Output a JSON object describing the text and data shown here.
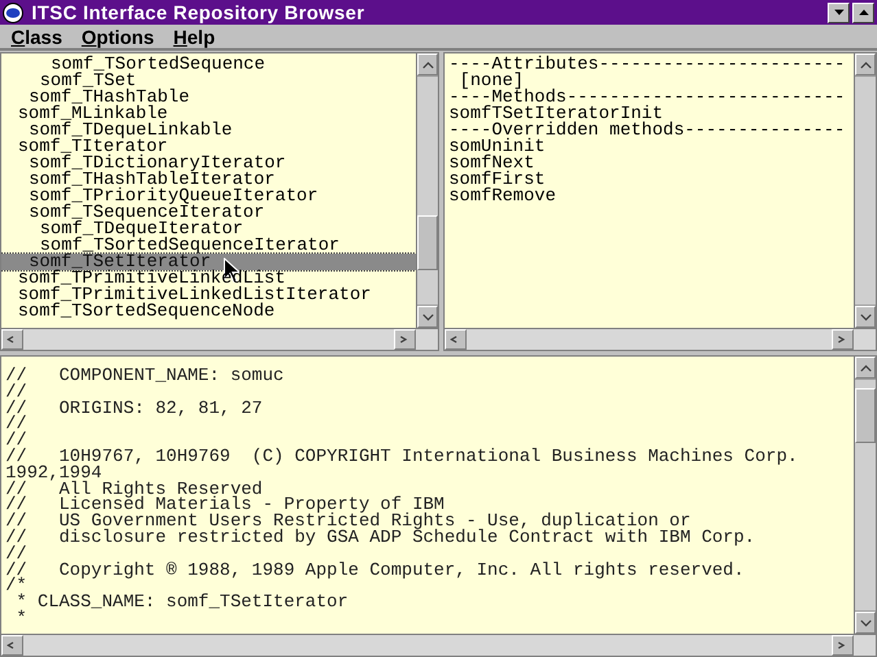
{
  "window": {
    "title": "ITSC Interface Repository Browser"
  },
  "menu": [
    "Class",
    "Options",
    "Help"
  ],
  "class_tree": [
    {
      "children": [
        {
          "children": [
            {
              "children": [
                {
                  "label": "somf_TSortedSequence",
                  "selected": false
                }
              ]
            },
            {
              "label": "somf_TSet",
              "selected": false
            }
          ]
        },
        {
          "label": "somf_THashTable",
          "selected": false
        }
      ]
    },
    {
      "label": "somf_MLinkable",
      "selected": false,
      "children": [
        {
          "label": "somf_TDequeLinkable",
          "selected": false
        }
      ]
    },
    {
      "label": "somf_TIterator",
      "selected": false,
      "children": [
        {
          "label": "somf_TDictionaryIterator",
          "selected": false
        },
        {
          "label": "somf_THashTableIterator",
          "selected": false
        },
        {
          "label": "somf_TPriorityQueueIterator",
          "selected": false
        },
        {
          "label": "somf_TSequenceIterator",
          "selected": false,
          "children": [
            {
              "label": "somf_TDequeIterator",
              "selected": false
            },
            {
              "label": "somf_TSortedSequenceIterator",
              "selected": false
            }
          ]
        },
        {
          "label": "somf_TSetIterator",
          "selected": true
        }
      ]
    },
    {
      "label": "somf_TPrimitiveLinkedList",
      "selected": false
    },
    {
      "label": "somf_TPrimitiveLinkedListIterator",
      "selected": false
    },
    {
      "label": "somf_TSortedSequenceNode",
      "selected": false
    }
  ],
  "members": [
    "----Attributes-----------------------",
    " [none]",
    "----Methods--------------------------",
    "somfTSetIteratorInit",
    "----Overridden methods---------------",
    "somUninit",
    "somfNext",
    "somfFirst",
    "somfRemove"
  ],
  "source": [
    "//   COMPONENT_NAME: somuc",
    "//",
    "//   ORIGINS: 82, 81, 27",
    "//",
    "//",
    "//   10H9767, 10H9769  (C) COPYRIGHT International Business Machines Corp.",
    "1992,1994",
    "//   All Rights Reserved",
    "//   Licensed Materials - Property of IBM",
    "//   US Government Users Restricted Rights - Use, duplication or",
    "//   disclosure restricted by GSA ADP Schedule Contract with IBM Corp.",
    "//",
    "//   Copyright ® 1988, 1989 Apple Computer, Inc. All rights reserved.",
    "/*",
    " * CLASS_NAME: somf_TSetIterator",
    " *"
  ]
}
